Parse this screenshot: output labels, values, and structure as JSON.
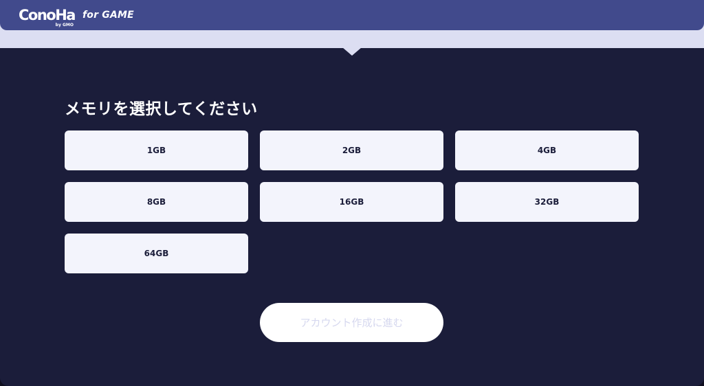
{
  "header": {
    "logo_text": "ConoHa",
    "logo_sub": "by GMO",
    "tagline": "for GAME"
  },
  "main": {
    "title": "メモリを選択してください",
    "options": [
      "1GB",
      "2GB",
      "4GB",
      "8GB",
      "16GB",
      "32GB",
      "64GB"
    ],
    "next_label": "アカウント作成に進む"
  },
  "colors": {
    "header_bg": "#414a8c",
    "page_bg": "#1b1d3a",
    "option_bg": "#f3f4fc",
    "disabled_text": "#d6d8ef"
  }
}
